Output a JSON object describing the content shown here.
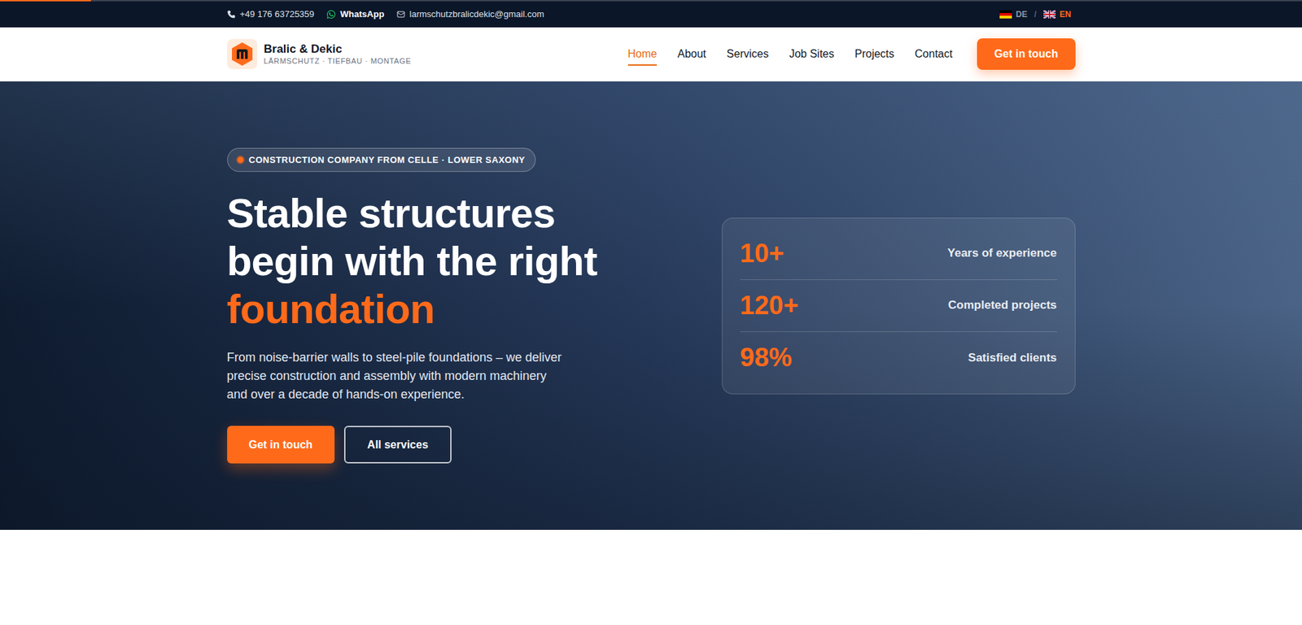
{
  "scroll_progress": {
    "level": 0.07
  },
  "top_bar": {
    "phone": "+49 176 63725359",
    "whatsapp": "WhatsApp",
    "email": "larmschutzbralicdekic@gmail.com",
    "separator": "/",
    "languages": [
      {
        "code": "DE",
        "selected": false
      },
      {
        "code": "EN",
        "selected": true
      }
    ]
  },
  "header": {
    "brand": {
      "name": "Bralic & Dekic",
      "tagline": "LÄRMSCHUTZ · TIEFBAU · MONTAGE"
    },
    "nav": [
      {
        "label": "Home",
        "selected": true
      },
      {
        "label": "About",
        "selected": false
      },
      {
        "label": "Services",
        "selected": false
      },
      {
        "label": "Job Sites",
        "selected": false
      },
      {
        "label": "Projects",
        "selected": false
      },
      {
        "label": "Contact",
        "selected": false
      }
    ],
    "cta": "Get in touch"
  },
  "hero": {
    "badge": "CONSTRUCTION COMPANY FROM CELLE · LOWER SAXONY",
    "title_lines": [
      "Stable structures",
      "begin with the right"
    ],
    "title_accent": "foundation",
    "text": "From noise-barrier walls to steel-pile foundations – we deliver precise construction and assembly with modern machinery and over a decade of hands-on experience.",
    "buttons": [
      {
        "label": "Get in touch",
        "kind": "primary"
      },
      {
        "label": "All services",
        "kind": "outline"
      }
    ],
    "stats": [
      {
        "value": "10+",
        "label": "Years of experience"
      },
      {
        "value": "120+",
        "label": "Completed projects"
      },
      {
        "value": "98%",
        "label": "Satisfied clients"
      }
    ]
  }
}
